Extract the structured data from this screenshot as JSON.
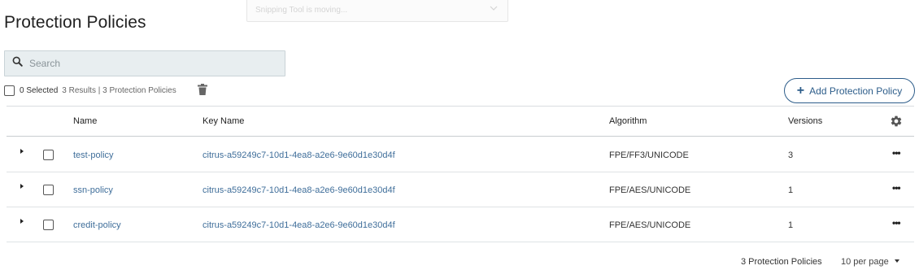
{
  "overlay": {
    "text": "Snipping Tool is moving..."
  },
  "page": {
    "title": "Protection Policies"
  },
  "search": {
    "placeholder": "Search"
  },
  "selection": {
    "selected_text": "0 Selected",
    "results_text": "3 Results | 3 Protection Policies"
  },
  "toolbar": {
    "add_label": "Add Protection Policy"
  },
  "table": {
    "columns": [
      "Name",
      "Key Name",
      "Algorithm",
      "Versions"
    ],
    "rows": [
      {
        "name": "test-policy",
        "key": "citrus-a59249c7-10d1-4ea8-a2e6-9e60d1e30d4f",
        "algorithm": "FPE/FF3/UNICODE",
        "versions": "3"
      },
      {
        "name": "ssn-policy",
        "key": "citrus-a59249c7-10d1-4ea8-a2e6-9e60d1e30d4f",
        "algorithm": "FPE/AES/UNICODE",
        "versions": "1"
      },
      {
        "name": "credit-policy",
        "key": "citrus-a59249c7-10d1-4ea8-a2e6-9e60d1e30d4f",
        "algorithm": "FPE/AES/UNICODE",
        "versions": "1"
      }
    ],
    "row_menu": "•••"
  },
  "footer": {
    "count_text": "3 Protection Policies",
    "per_page": "10 per page"
  },
  "colors": {
    "accent": "#2d5d8a",
    "link": "#3f6e9a",
    "search_bg": "#e8eef0"
  },
  "icons": {
    "search": "search-icon",
    "trash": "trash-icon",
    "settings": "gear-icon",
    "expand": "caret-right-icon",
    "more": "more-horizontal-icon"
  }
}
